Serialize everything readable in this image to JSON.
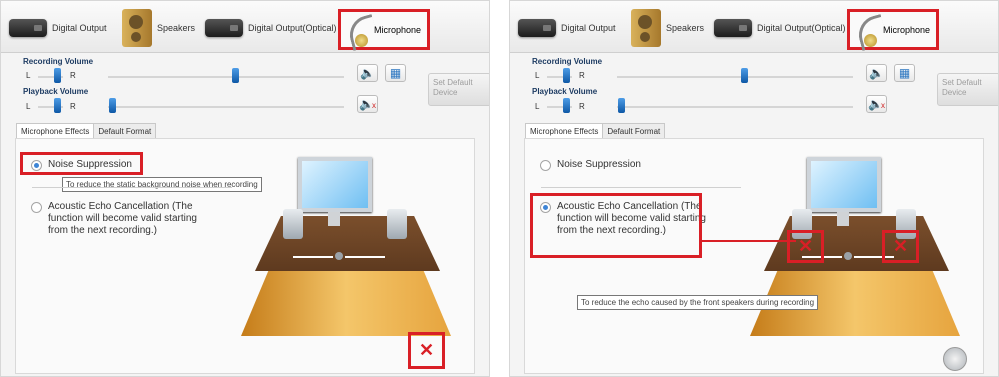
{
  "tabs": {
    "digital_output": "Digital Output",
    "speakers": "Speakers",
    "digital_output_optical": "Digital Output(Optical)",
    "microphone": "Microphone"
  },
  "volume": {
    "recording_label": "Recording Volume",
    "playback_label": "Playback Volume",
    "left": "L",
    "right": "R",
    "set_default_device": "Set Default Device"
  },
  "subtabs": {
    "effects": "Microphone Effects",
    "format": "Default Format"
  },
  "left_panel": {
    "noise": "Noise Suppression",
    "noise_tip": "To reduce the static background noise when recording",
    "aec": "Acoustic Echo Cancellation (The function will become valid starting from the next recording.)"
  },
  "right_panel": {
    "noise": "Noise Suppression",
    "aec": "Acoustic Echo Cancellation (The function will become valid starting from the next recording.)",
    "aec_tip": "To reduce the echo caused by the front speakers during recording"
  },
  "accent_red": "#d91f26"
}
